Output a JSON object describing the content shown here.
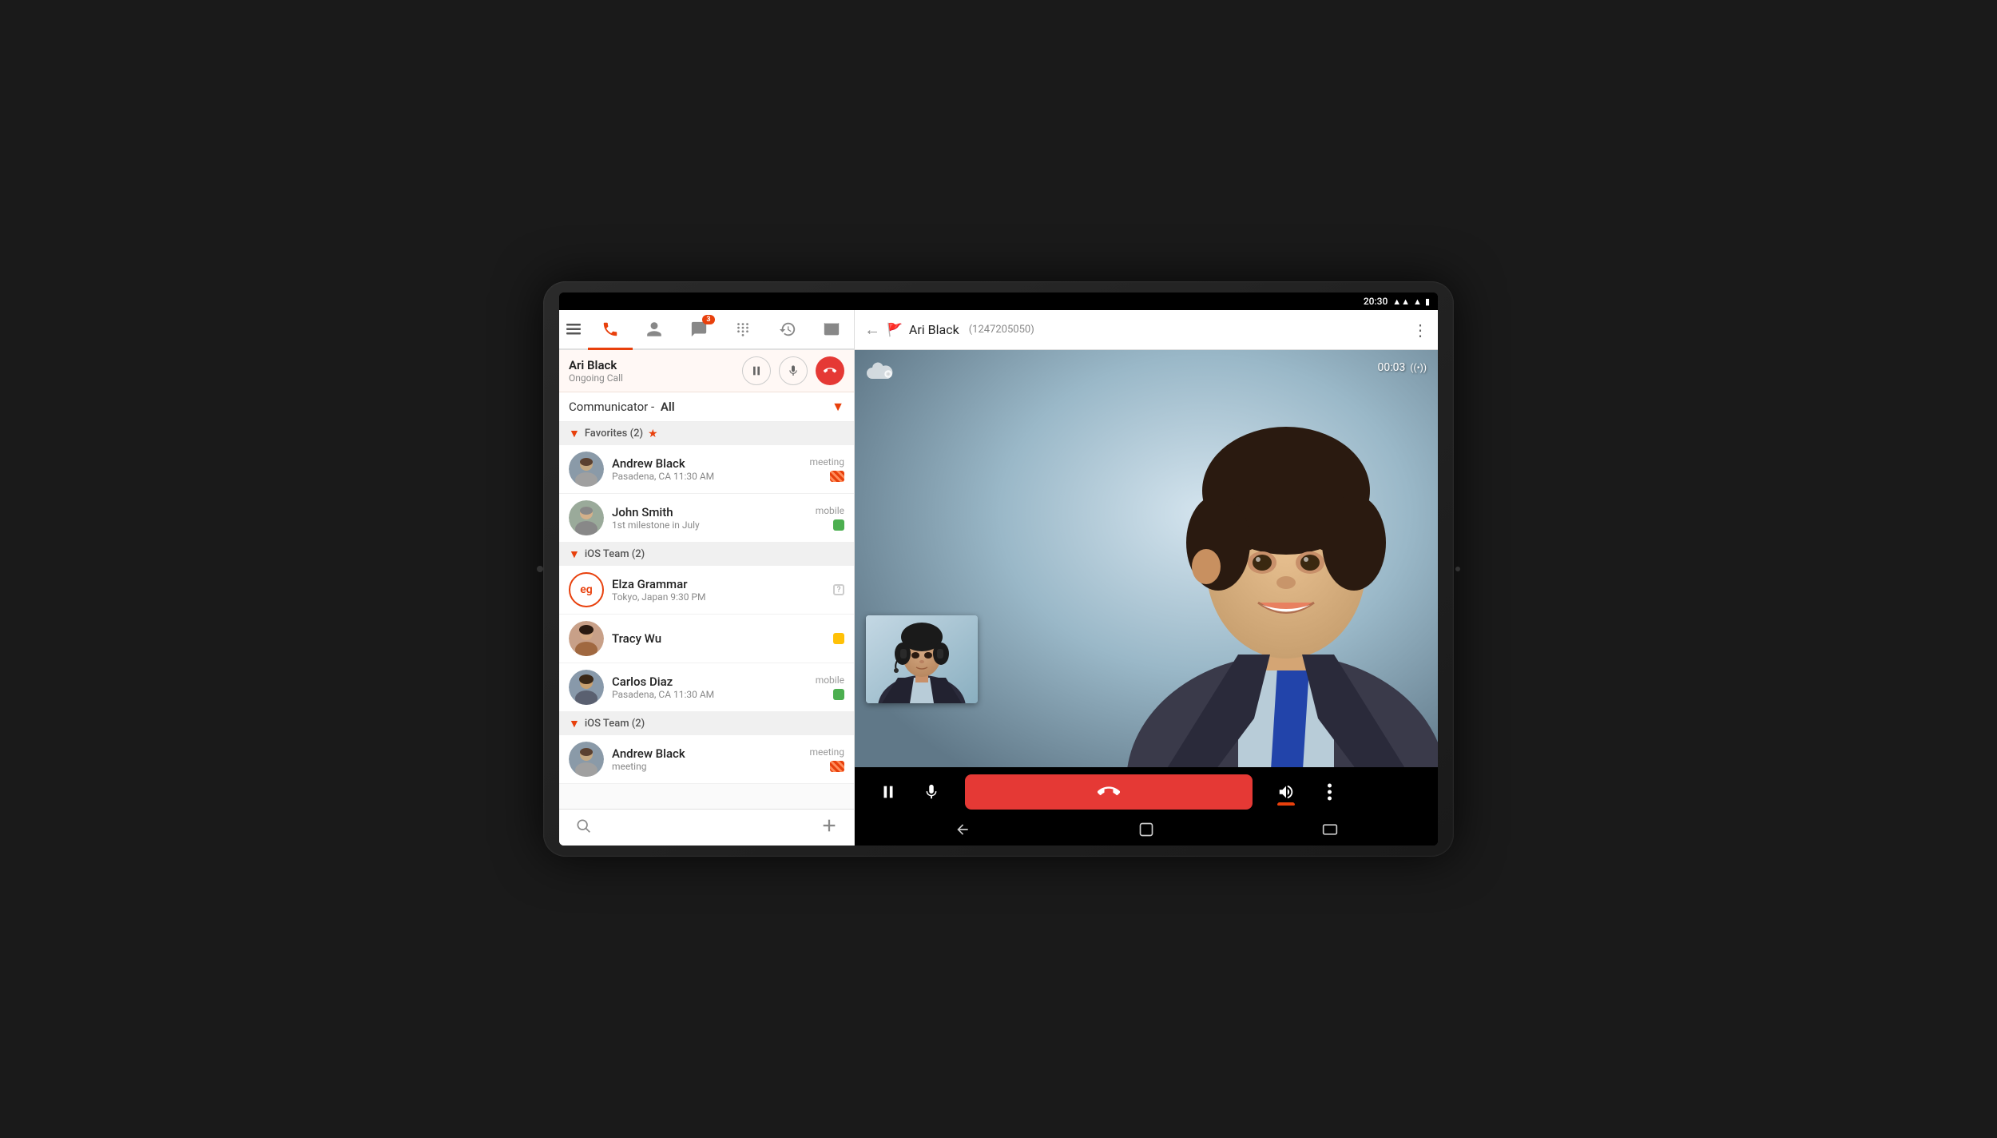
{
  "device": {
    "time": "20:30",
    "signal": "▲▲▲",
    "wifi": "▲",
    "battery": "▮"
  },
  "header": {
    "back_icon": "←",
    "flag_icon": "🚩",
    "caller_name": "Ari Black",
    "caller_number": "(1247205050)",
    "more_icon": "⋮"
  },
  "active_call": {
    "name": "Ari Black",
    "status": "Ongoing Call",
    "pause_label": "⏸",
    "mute_label": "🎤",
    "end_label": "📞"
  },
  "filter": {
    "label": "Communicator -",
    "value": "All",
    "arrow": "▼"
  },
  "tabs": [
    {
      "id": "menu",
      "icon": "☰",
      "active": false
    },
    {
      "id": "phone",
      "icon": "📞",
      "active": true
    },
    {
      "id": "contacts",
      "icon": "👤",
      "active": false
    },
    {
      "id": "chat",
      "icon": "💬",
      "active": false
    },
    {
      "id": "dialpad",
      "icon": "⌨",
      "active": false
    },
    {
      "id": "history",
      "icon": "⏱",
      "active": false
    },
    {
      "id": "voicemail",
      "icon": "📻",
      "active": false
    }
  ],
  "groups": [
    {
      "id": "favorites",
      "label": "Favorites (2)",
      "expanded": true,
      "star": true,
      "contacts": [
        {
          "id": "andrew-black",
          "name": "Andrew Black",
          "sub": "Pasadena, CA 11:30 AM",
          "status_label": "meeting",
          "status_type": "meeting",
          "avatar_type": "photo",
          "avatar_color": "#8a9aa8"
        },
        {
          "id": "john-smith",
          "name": "John Smith",
          "sub": "1st milestone in July",
          "status_label": "mobile",
          "status_type": "green",
          "avatar_type": "photo",
          "avatar_color": "#9aaa9a"
        }
      ]
    },
    {
      "id": "ios-team-1",
      "label": "iOS Team (2)",
      "expanded": true,
      "star": false,
      "contacts": [
        {
          "id": "elza-grammar",
          "name": "Elza Grammar",
          "sub": "Tokyo, Japan 9:30 PM",
          "status_label": "",
          "status_type": "unknown",
          "avatar_type": "initials",
          "initials": "eg",
          "avatar_color": "#e8400c"
        },
        {
          "id": "tracy-wu",
          "name": "Tracy Wu",
          "sub": "",
          "status_label": "",
          "status_type": "yellow",
          "avatar_type": "photo",
          "avatar_color": "#c8a088"
        },
        {
          "id": "carlos-diaz",
          "name": "Carlos Diaz",
          "sub": "Pasadena, CA 11:30 AM",
          "status_label": "mobile",
          "status_type": "green",
          "avatar_type": "photo",
          "avatar_color": "#8899aa"
        }
      ]
    },
    {
      "id": "ios-team-2",
      "label": "iOS Team (2)",
      "expanded": true,
      "star": false,
      "contacts": [
        {
          "id": "andrew-black-2",
          "name": "Andrew Black",
          "sub": "",
          "status_label": "meeting",
          "status_type": "meeting",
          "avatar_type": "photo",
          "avatar_color": "#8a9aa8"
        }
      ]
    }
  ],
  "video": {
    "timer": "00:03",
    "speaker_icon": "((•))",
    "cloud_icon": "☁"
  },
  "video_controls": {
    "pause": "⏸",
    "mute": "🎤",
    "end": "☎",
    "speaker": "🔊",
    "more": "⋮"
  },
  "nav": {
    "back": "←",
    "home": "⌂",
    "recents": "▭"
  }
}
